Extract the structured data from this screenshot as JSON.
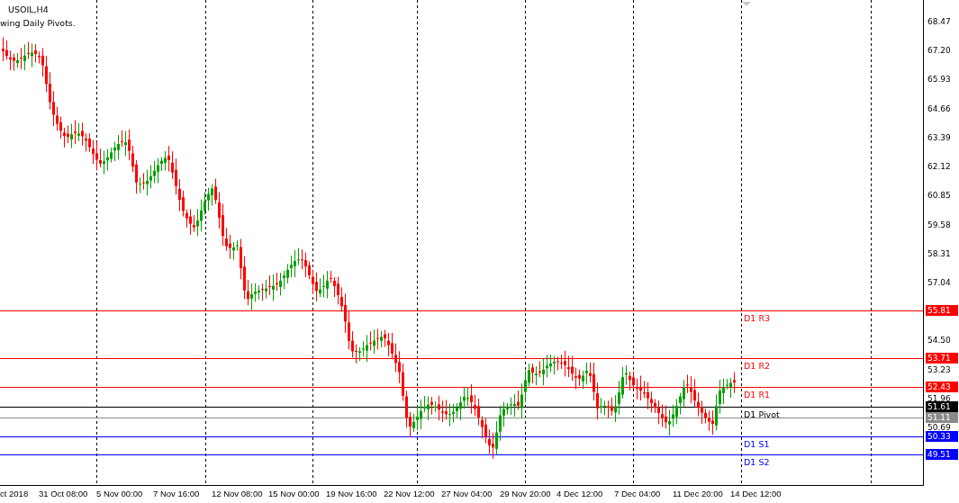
{
  "chart": {
    "symbol": "USOIL,H4",
    "indicator_note": "wing Daily Pivots."
  },
  "price_scale": {
    "ticks": [
      "68.47",
      "67.20",
      "65.93",
      "64.66",
      "63.39",
      "62.12",
      "60.85",
      "59.58",
      "58.31",
      "57.04",
      "54.50",
      "53.23",
      "51.96",
      "50.69"
    ]
  },
  "levels": [
    {
      "kind": "resistance",
      "label": "D1 R3",
      "price": "55.81"
    },
    {
      "kind": "resistance",
      "label": "D1 R2",
      "price": "53.71"
    },
    {
      "kind": "resistance",
      "label": "D1 R1",
      "price": "52.43"
    },
    {
      "kind": "pivot",
      "label": "D1 Pivot",
      "price": "51.61"
    },
    {
      "kind": "bid",
      "price": "51.11"
    },
    {
      "kind": "support",
      "label": "D1 S1",
      "price": "50.33"
    },
    {
      "kind": "support",
      "label": "D1 S2",
      "price": "49.51"
    }
  ],
  "time_scale": {
    "labels": [
      "ct 2018",
      "31 Oct 08:00",
      "5 Nov 00:00",
      "7 Nov 16:00",
      "12 Nov 08:00",
      "15 Nov 00:00",
      "19 Nov 16:00",
      "22 Nov 12:00",
      "27 Nov 04:00",
      "29 Nov 20:00",
      "4 Dec 12:00",
      "7 Dec 04:00",
      "11 Dec 20:00",
      "14 Dec 12:00"
    ]
  }
}
